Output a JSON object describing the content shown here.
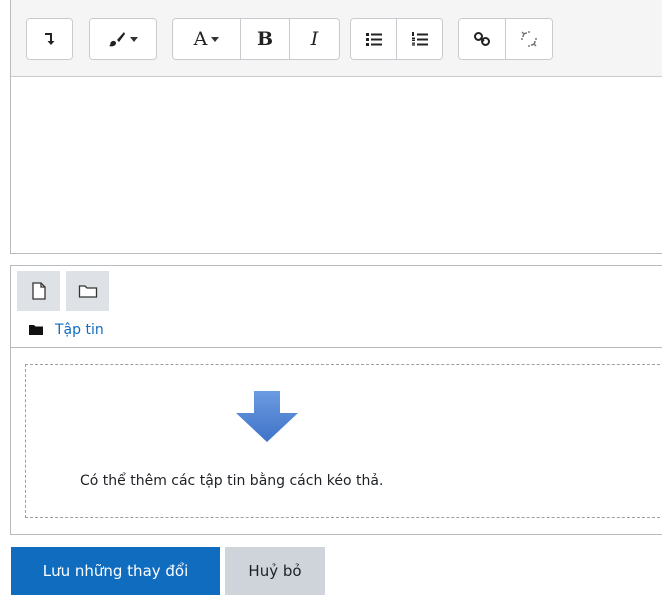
{
  "files": {
    "folder_label": "Tập tin",
    "dropzone_text": "Có thể thêm các tập tin bằng cách kéo thả."
  },
  "actions": {
    "save_label": "Lưu những thay đổi",
    "cancel_label": "Huỷ bỏ"
  },
  "toolbar": {
    "font_label": "A",
    "bold_label": "B",
    "italic_label": "I"
  },
  "colors": {
    "primary": "#0f6cbf",
    "secondary": "#ced4da",
    "toolbar_bg": "#f5f5f5",
    "arrow": "#4a7fd0"
  }
}
